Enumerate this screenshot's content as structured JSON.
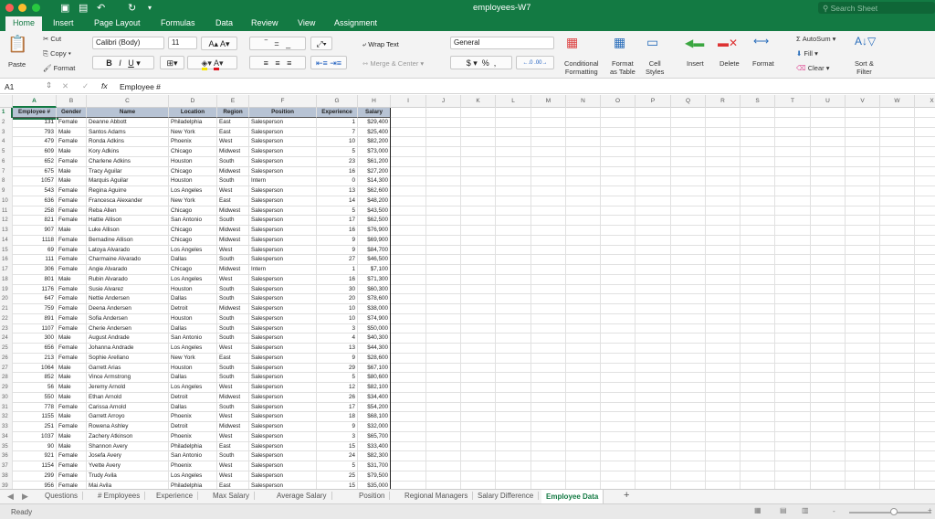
{
  "window": {
    "title": "employees-W7",
    "search_placeholder": "Search Sheet"
  },
  "ribbon_tabs": [
    "Home",
    "Insert",
    "Page Layout",
    "Formulas",
    "Data",
    "Review",
    "View",
    "Assignment"
  ],
  "ribbon": {
    "paste": "Paste",
    "cut": "Cut",
    "copy": "Copy",
    "format": "Format",
    "font": "Calibri (Body)",
    "size": "11",
    "wrap": "Wrap Text",
    "merge": "Merge & Center",
    "numfmt": "General",
    "cond1": "Conditional",
    "cond2": "Formatting",
    "fat1": "Format",
    "fat2": "as Table",
    "cs1": "Cell",
    "cs2": "Styles",
    "insert": "Insert",
    "delete": "Delete",
    "formatc": "Format",
    "autosum": "AutoSum",
    "fill": "Fill",
    "clear": "Clear",
    "sort1": "Sort &",
    "sort2": "Filter",
    "bold": "B",
    "italic": "I",
    "underline": "U",
    "dollar": "$",
    "percent": "%",
    "comma": ","
  },
  "formula_bar": {
    "cell": "A1",
    "fx": "fx",
    "value": "Employee #"
  },
  "columns": [
    "A",
    "B",
    "C",
    "D",
    "E",
    "F",
    "G",
    "H",
    "I",
    "J",
    "K",
    "L",
    "M",
    "N",
    "O",
    "P",
    "Q",
    "R",
    "S",
    "T",
    "U",
    "V",
    "W",
    "X"
  ],
  "headers": [
    "Employee #",
    "Gender",
    "Name",
    "Location",
    "Region",
    "Position",
    "Experience",
    "Salary"
  ],
  "rows": [
    [
      "131",
      "Female",
      "Deanne Abbott",
      "Philadelphia",
      "East",
      "Salesperson",
      "1",
      "$29,400"
    ],
    [
      "793",
      "Male",
      "Santos Adams",
      "New York",
      "East",
      "Salesperson",
      "7",
      "$25,400"
    ],
    [
      "479",
      "Female",
      "Ronda Adkins",
      "Phoenix",
      "West",
      "Salesperson",
      "10",
      "$82,200"
    ],
    [
      "609",
      "Male",
      "Kory Adkins",
      "Chicago",
      "Midwest",
      "Salesperson",
      "5",
      "$73,000"
    ],
    [
      "652",
      "Female",
      "Charlene Adkins",
      "Houston",
      "South",
      "Salesperson",
      "23",
      "$61,200"
    ],
    [
      "675",
      "Male",
      "Tracy Aguilar",
      "Chicago",
      "Midwest",
      "Salesperson",
      "16",
      "$27,200"
    ],
    [
      "1057",
      "Male",
      "Marquis Aguilar",
      "Houston",
      "South",
      "Intern",
      "0",
      "$14,300"
    ],
    [
      "543",
      "Female",
      "Regina Aguirre",
      "Los Angeles",
      "West",
      "Salesperson",
      "13",
      "$62,600"
    ],
    [
      "636",
      "Female",
      "Francesca Alexander",
      "New York",
      "East",
      "Salesperson",
      "14",
      "$48,200"
    ],
    [
      "258",
      "Female",
      "Reba Allen",
      "Chicago",
      "Midwest",
      "Salesperson",
      "5",
      "$43,500"
    ],
    [
      "821",
      "Female",
      "Hattie Allison",
      "San Antonio",
      "South",
      "Salesperson",
      "17",
      "$62,500"
    ],
    [
      "907",
      "Male",
      "Luke Allison",
      "Chicago",
      "Midwest",
      "Salesperson",
      "16",
      "$76,900"
    ],
    [
      "1118",
      "Female",
      "Bernadine Allison",
      "Chicago",
      "Midwest",
      "Salesperson",
      "9",
      "$69,900"
    ],
    [
      "69",
      "Female",
      "Latoya Alvarado",
      "Los Angeles",
      "West",
      "Salesperson",
      "9",
      "$84,700"
    ],
    [
      "111",
      "Female",
      "Charmaine Alvarado",
      "Dallas",
      "South",
      "Salesperson",
      "27",
      "$46,500"
    ],
    [
      "306",
      "Female",
      "Angie Alvarado",
      "Chicago",
      "Midwest",
      "Intern",
      "1",
      "$7,100"
    ],
    [
      "801",
      "Male",
      "Rubin Alvarado",
      "Los Angeles",
      "West",
      "Salesperson",
      "16",
      "$71,300"
    ],
    [
      "1176",
      "Female",
      "Susie Alvarez",
      "Houston",
      "South",
      "Salesperson",
      "30",
      "$60,300"
    ],
    [
      "647",
      "Female",
      "Nettie Andersen",
      "Dallas",
      "South",
      "Salesperson",
      "20",
      "$78,600"
    ],
    [
      "759",
      "Female",
      "Deena Andersen",
      "Detroit",
      "Midwest",
      "Salesperson",
      "10",
      "$38,000"
    ],
    [
      "891",
      "Female",
      "Sofia Andersen",
      "Houston",
      "South",
      "Salesperson",
      "10",
      "$74,900"
    ],
    [
      "1107",
      "Female",
      "Cherie Andersen",
      "Dallas",
      "South",
      "Salesperson",
      "3",
      "$50,000"
    ],
    [
      "300",
      "Male",
      "August Andrade",
      "San Antonio",
      "South",
      "Salesperson",
      "4",
      "$40,300"
    ],
    [
      "656",
      "Female",
      "Johanna Andrade",
      "Los Angeles",
      "West",
      "Salesperson",
      "13",
      "$44,300"
    ],
    [
      "213",
      "Female",
      "Sophie Arellano",
      "New York",
      "East",
      "Salesperson",
      "9",
      "$28,600"
    ],
    [
      "1064",
      "Male",
      "Garrett Arias",
      "Houston",
      "South",
      "Salesperson",
      "29",
      "$67,100"
    ],
    [
      "852",
      "Male",
      "Vince Armstrong",
      "Dallas",
      "South",
      "Salesperson",
      "5",
      "$80,600"
    ],
    [
      "56",
      "Male",
      "Jeremy Arnold",
      "Los Angeles",
      "West",
      "Salesperson",
      "12",
      "$82,100"
    ],
    [
      "550",
      "Male",
      "Ethan Arnold",
      "Detroit",
      "Midwest",
      "Salesperson",
      "26",
      "$34,400"
    ],
    [
      "778",
      "Female",
      "Carissa Arnold",
      "Dallas",
      "South",
      "Salesperson",
      "17",
      "$54,200"
    ],
    [
      "1155",
      "Male",
      "Garrett Arroyo",
      "Phoenix",
      "West",
      "Salesperson",
      "18",
      "$68,100"
    ],
    [
      "251",
      "Female",
      "Rowena Ashley",
      "Detroit",
      "Midwest",
      "Salesperson",
      "9",
      "$32,000"
    ],
    [
      "1037",
      "Male",
      "Zachery Atkinson",
      "Phoenix",
      "West",
      "Salesperson",
      "3",
      "$65,700"
    ],
    [
      "90",
      "Male",
      "Shannon Avery",
      "Philadelphia",
      "East",
      "Salesperson",
      "15",
      "$33,400"
    ],
    [
      "921",
      "Female",
      "Josefa Avery",
      "San Antonio",
      "South",
      "Salesperson",
      "24",
      "$82,300"
    ],
    [
      "1154",
      "Female",
      "Yvette Avery",
      "Phoenix",
      "West",
      "Salesperson",
      "5",
      "$31,700"
    ],
    [
      "299",
      "Female",
      "Trudy Avila",
      "Los Angeles",
      "West",
      "Salesperson",
      "25",
      "$79,500"
    ],
    [
      "956",
      "Female",
      "Mai Avila",
      "Philadelphia",
      "East",
      "Salesperson",
      "15",
      "$35,000"
    ]
  ],
  "sheet_tabs": [
    "Questions",
    "# Employees",
    "Experience",
    "Max Salary",
    "Average Salary",
    "Position",
    "Regional Managers",
    "Salary Difference",
    "Employee Data"
  ],
  "active_sheet": "Employee Data",
  "status": "Ready",
  "colors": {
    "accent": "#137a43",
    "header_fill": "#b7c3d4"
  }
}
